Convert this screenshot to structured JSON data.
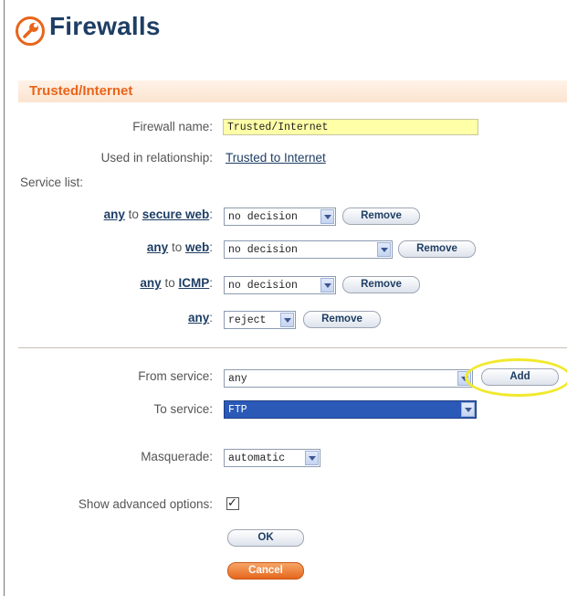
{
  "header": {
    "title": "Firewalls",
    "logo_icon": "wrench-icon",
    "accent": "#e8651a",
    "title_color": "#1e3e64"
  },
  "section": {
    "title": "Trusted/Internet"
  },
  "form": {
    "firewall_name_label": "Firewall name:",
    "firewall_name_value": "Trusted/Internet",
    "used_in_label": "Used in relationship:",
    "used_in_link": "Trusted to Internet",
    "service_list_label": "Service list:"
  },
  "services": [
    {
      "from": "any",
      "joiner": "to",
      "to": "secure web",
      "decision": "no decision",
      "remove": "Remove"
    },
    {
      "from": "any",
      "joiner": "to",
      "to": "web",
      "decision": "no decision",
      "remove": "Remove"
    },
    {
      "from": "any",
      "joiner": "to",
      "to": "ICMP",
      "decision": "no decision",
      "remove": "Remove"
    },
    {
      "from": "any",
      "joiner": "",
      "to": "",
      "decision": "reject",
      "remove": "Remove"
    }
  ],
  "add_rule": {
    "from_label": "From service:",
    "from_value": "any",
    "add_button": "Add",
    "to_label": "To service:",
    "to_value": "FTP"
  },
  "masquerade": {
    "label": "Masquerade:",
    "value": "automatic"
  },
  "advanced": {
    "label": "Show advanced options:",
    "checked": true
  },
  "actions": {
    "ok": "OK",
    "cancel": "Cancel"
  },
  "colors": {
    "highlight": "#f1e92c",
    "cancel": "#e5671c"
  }
}
